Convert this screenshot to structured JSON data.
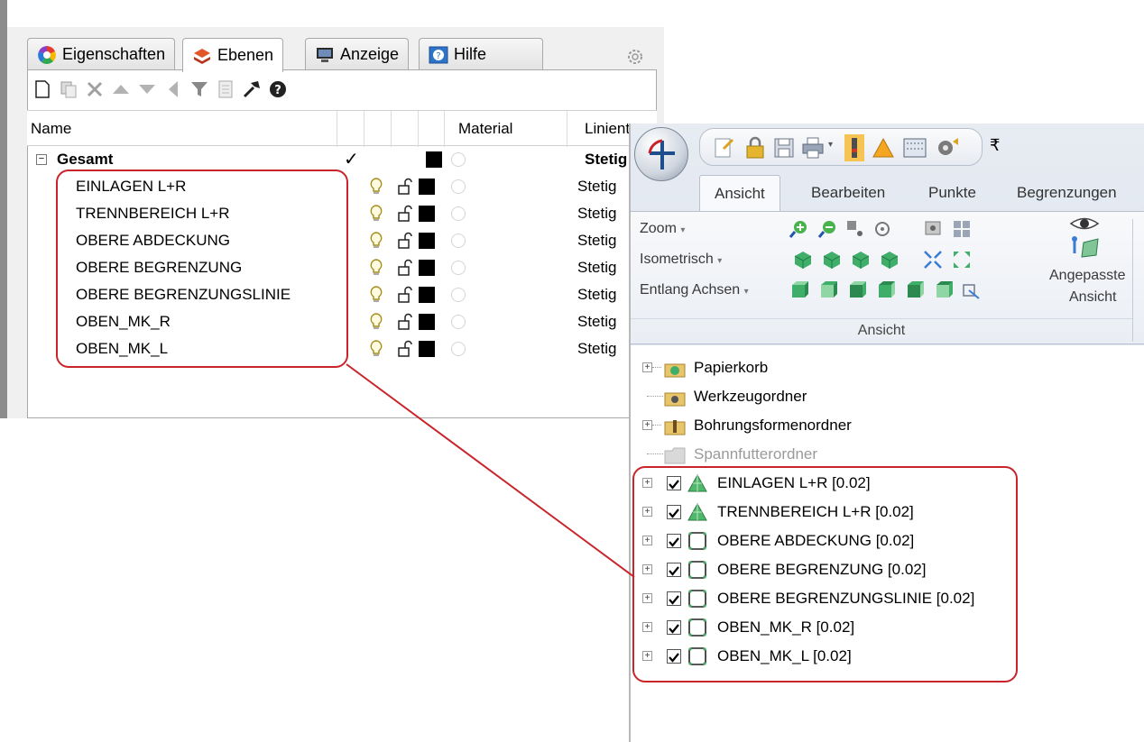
{
  "layers_panel": {
    "tabs": [
      {
        "label": "Eigenschaften",
        "icon": "color-wheel-icon"
      },
      {
        "label": "Ebenen",
        "icon": "layers-icon"
      },
      {
        "label": "Anzeige",
        "icon": "display-icon"
      },
      {
        "label": "Hilfe",
        "icon": "help-icon"
      }
    ],
    "toolbar_icons": [
      "new-layer-icon",
      "new-sublayer-icon",
      "delete-icon",
      "move-up-icon",
      "move-down-icon",
      "move-to-parent-icon",
      "filter-icon",
      "select-objects-icon",
      "tools-icon",
      "help-icon"
    ],
    "columns": {
      "name": "Name",
      "material": "Material",
      "linetype": "Linientyp"
    },
    "parent": {
      "name": "Gesamt",
      "current": "✓",
      "linetype": "Stetig"
    },
    "layers": [
      {
        "name": "EINLAGEN L+R",
        "linetype": "Stetig"
      },
      {
        "name": "TRENNBEREICH L+R",
        "linetype": "Stetig"
      },
      {
        "name": "OBERE ABDECKUNG",
        "linetype": "Stetig"
      },
      {
        "name": "OBERE BEGRENZUNG",
        "linetype": "Stetig"
      },
      {
        "name": "OBERE BEGRENZUNGSLINIE",
        "linetype": "Stetig"
      },
      {
        "name": "OBEN_MK_R",
        "linetype": "Stetig"
      },
      {
        "name": "OBEN_MK_L",
        "linetype": "Stetig"
      }
    ]
  },
  "cam_window": {
    "qat_arrow": "₹",
    "ribbon_tabs": [
      "Ansicht",
      "Bearbeiten",
      "Punkte",
      "Begrenzungen"
    ],
    "ribbon_rows": [
      "Zoom",
      "Isometrisch",
      "Entlang Achsen"
    ],
    "custom_view": {
      "line1": "Angepasste",
      "line2": "Ansicht"
    },
    "group_label": "Ansicht",
    "folders": [
      {
        "label": "Papierkorb",
        "icon": "recycle-bin-icon"
      },
      {
        "label": "Werkzeugordner",
        "icon": "tool-folder-icon"
      },
      {
        "label": "Bohrungsformenordner",
        "icon": "hole-folder-icon"
      },
      {
        "label": "Spannfutterordner",
        "icon": "chuck-folder-icon"
      }
    ],
    "geometry_items": [
      {
        "label": "EINLAGEN L+R [0.02]",
        "icon": "triangle-mesh-icon"
      },
      {
        "label": "TRENNBEREICH L+R [0.02]",
        "icon": "triangle-mesh-icon"
      },
      {
        "label": "OBERE ABDECKUNG [0.02]",
        "icon": "boundary-icon"
      },
      {
        "label": "OBERE BEGRENZUNG [0.02]",
        "icon": "boundary-icon"
      },
      {
        "label": "OBERE BEGRENZUNGSLINIE [0.02]",
        "icon": "boundary-icon"
      },
      {
        "label": "OBEN_MK_R [0.02]",
        "icon": "boundary-icon"
      },
      {
        "label": "OBEN_MK_L [0.02]",
        "icon": "boundary-icon"
      }
    ]
  },
  "colors": {
    "callout": "#c8242a",
    "layer_swatch": "#000000"
  }
}
